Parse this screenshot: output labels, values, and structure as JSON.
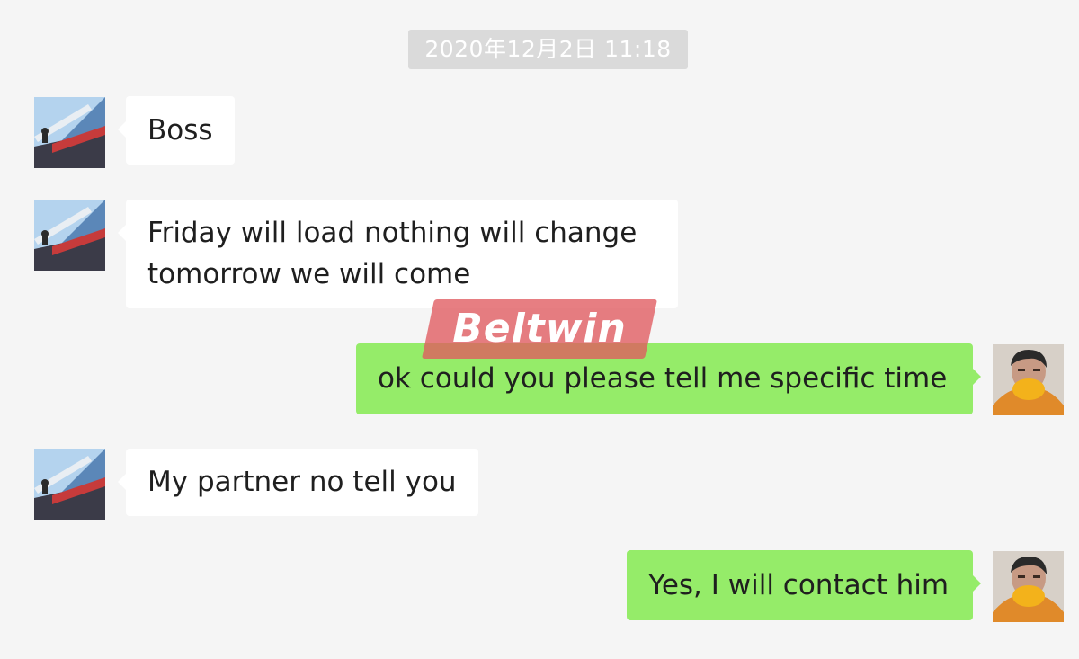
{
  "chat": {
    "timestamp": "2020年12月2日 11:18",
    "messages": [
      {
        "side": "incoming",
        "lines": [
          "Boss"
        ]
      },
      {
        "side": "incoming",
        "lines": [
          "Friday will load nothing will change",
          "tomorrow we will come"
        ]
      },
      {
        "side": "outgoing",
        "lines": [
          "ok could you please tell me specific time"
        ]
      },
      {
        "side": "incoming",
        "lines": [
          "My partner no tell you"
        ]
      },
      {
        "side": "outgoing",
        "lines": [
          "Yes, I will contact him"
        ]
      }
    ]
  },
  "watermark": {
    "text": "Beltwin"
  },
  "colors": {
    "background": "#f5f5f5",
    "incoming_bubble": "#ffffff",
    "outgoing_bubble": "#95ec69",
    "timestamp_bg": "#dadada",
    "watermark": "#e05a5f"
  },
  "icons": {
    "contact_avatar": "contact-avatar-icon",
    "user_avatar": "user-avatar-icon"
  }
}
